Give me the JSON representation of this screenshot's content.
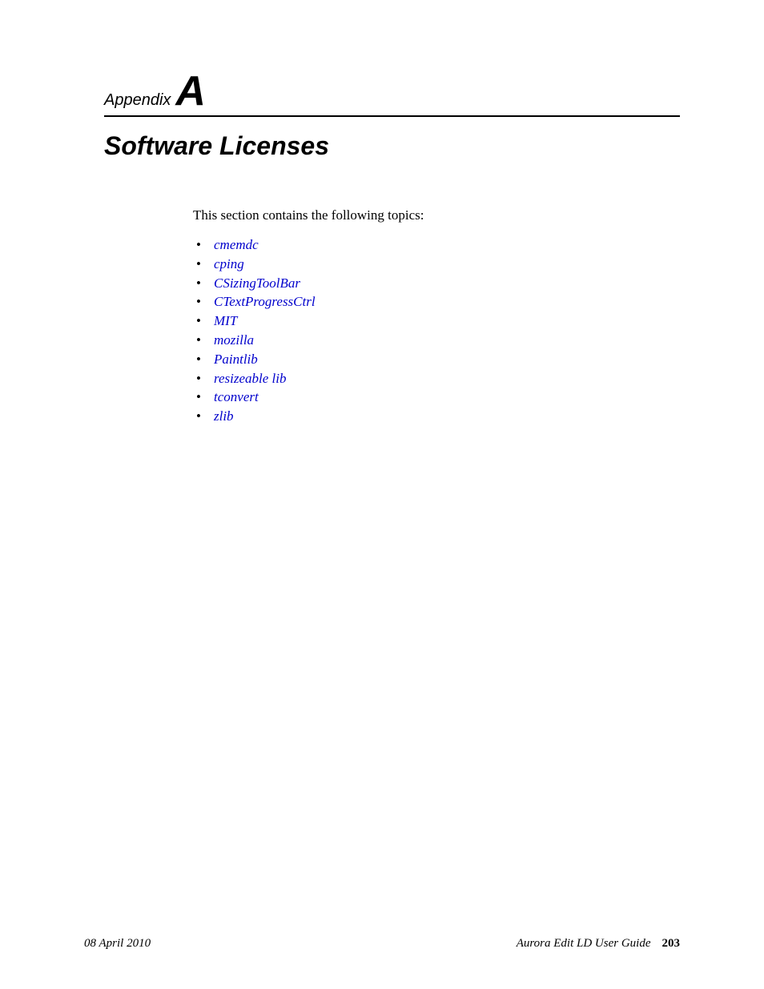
{
  "header": {
    "appendix_word": "Appendix",
    "appendix_letter": "A"
  },
  "title": "Software Licenses",
  "intro": "This section contains the following topics:",
  "topics": [
    "cmemdc",
    "cping",
    "CSizingToolBar",
    "CTextProgressCtrl",
    "MIT",
    "mozilla",
    "Paintlib",
    "resizeable lib",
    "tconvert",
    "zlib"
  ],
  "footer": {
    "date": "08 April 2010",
    "guide": "Aurora Edit LD User Guide",
    "page": "203"
  }
}
